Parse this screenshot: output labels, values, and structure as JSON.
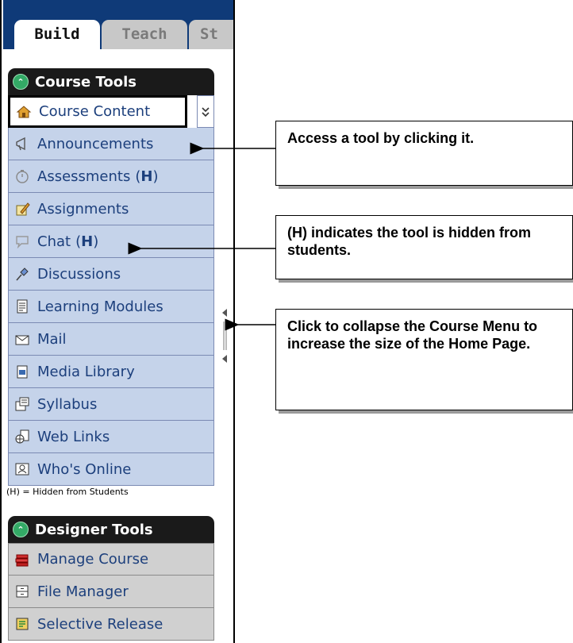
{
  "tabs": [
    {
      "label": "Build"
    },
    {
      "label": "Teach"
    },
    {
      "label": "St"
    }
  ],
  "course_tools": {
    "title": "Course Tools",
    "items": [
      {
        "label": "Course Content",
        "icon": "home-icon",
        "selected": true
      },
      {
        "label": "Announcements",
        "icon": "megaphone-icon"
      },
      {
        "label": "Assessments",
        "hidden_marker": "(H)",
        "icon": "stopwatch-icon"
      },
      {
        "label": "Assignments",
        "icon": "pencil-paper-icon"
      },
      {
        "label": "Chat",
        "hidden_marker": "(H)",
        "icon": "chat-bubble-icon"
      },
      {
        "label": "Discussions",
        "icon": "pushpin-icon"
      },
      {
        "label": "Learning Modules",
        "icon": "document-icon"
      },
      {
        "label": "Mail",
        "icon": "envelope-icon"
      },
      {
        "label": "Media Library",
        "icon": "media-library-icon"
      },
      {
        "label": "Syllabus",
        "icon": "syllabus-icon"
      },
      {
        "label": "Web Links",
        "icon": "globe-page-icon"
      },
      {
        "label": "Who's Online",
        "icon": "person-card-icon"
      }
    ],
    "legend": "(H) = Hidden from Students"
  },
  "designer_tools": {
    "title": "Designer Tools",
    "items": [
      {
        "label": "Manage Course",
        "icon": "books-icon"
      },
      {
        "label": "File Manager",
        "icon": "file-cabinet-icon"
      },
      {
        "label": "Selective Release",
        "icon": "release-icon"
      }
    ]
  },
  "callouts": [
    {
      "text": "Access a tool by clicking it."
    },
    {
      "text": "(H) indicates the tool is hidden from students."
    },
    {
      "text": "Click to collapse the Course Menu to increase the size of the Home Page."
    }
  ],
  "colors": {
    "tab_bar": "#0f3a78",
    "item_bg": "#c5d3ea",
    "item_text": "#1c3f7c",
    "designer_item_bg": "#d0d0d0",
    "header_bg": "#1a1a1a"
  }
}
